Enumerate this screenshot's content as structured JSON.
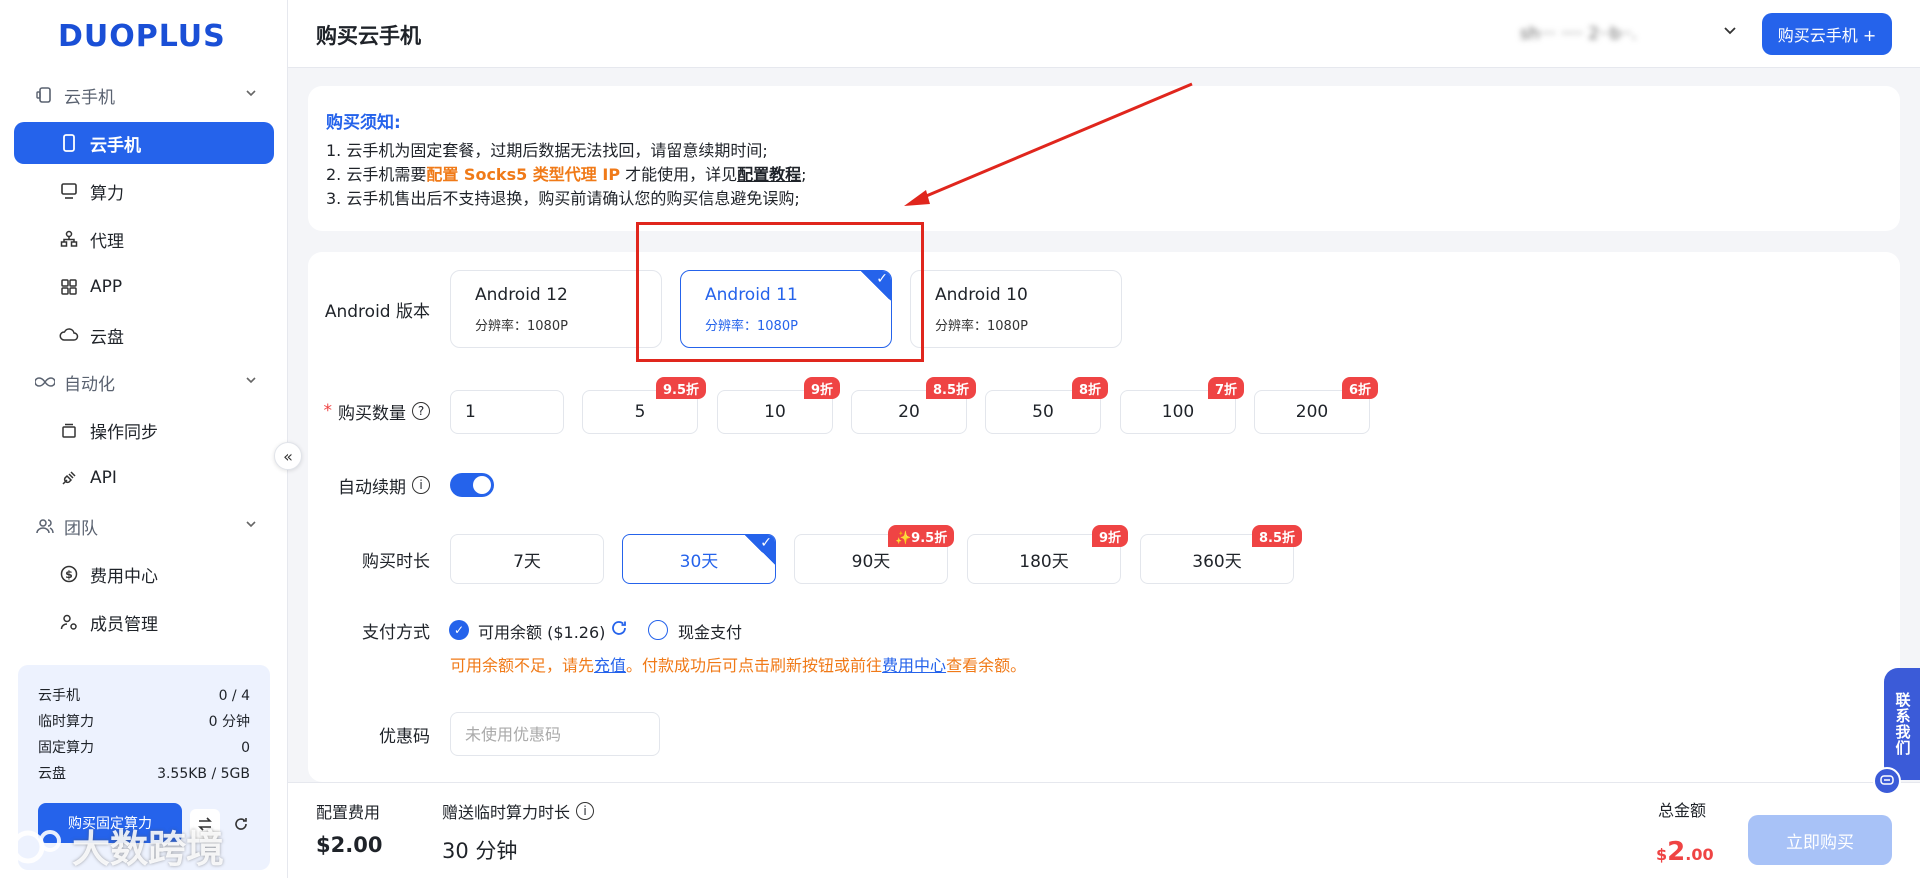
{
  "app": {
    "logo": "DUOPLUS"
  },
  "sidebar": {
    "groups": [
      {
        "label": "云手机",
        "icon": "phone-outline-icon"
      },
      {
        "label": "自动化",
        "icon": "infinity-icon"
      },
      {
        "label": "团队",
        "icon": "team-icon"
      }
    ],
    "items": [
      {
        "label": "云手机",
        "icon": "phone-icon",
        "active": true
      },
      {
        "label": "算力",
        "icon": "monitor-icon"
      },
      {
        "label": "代理",
        "icon": "network-icon"
      },
      {
        "label": "APP",
        "icon": "grid-icon"
      },
      {
        "label": "云盘",
        "icon": "cloud-icon"
      },
      {
        "label": "操作同步",
        "icon": "layers-icon"
      },
      {
        "label": "API",
        "icon": "plug-icon"
      },
      {
        "label": "费用中心",
        "icon": "dollar-icon"
      },
      {
        "label": "成员管理",
        "icon": "user-settings-icon"
      }
    ],
    "collapse_glyph": "«"
  },
  "stats": {
    "rows": [
      {
        "label": "云手机",
        "value": "0 / 4"
      },
      {
        "label": "临时算力",
        "value": "0 分钟"
      },
      {
        "label": "固定算力",
        "value": "0"
      },
      {
        "label": "云盘",
        "value": "3.55KB / 5GB"
      }
    ],
    "buy_button": "购买固定算力"
  },
  "watermark": "大数跨境",
  "header": {
    "title": "购买云手机",
    "user": "sh··· ···· 2··b··.",
    "button": "购买云手机 +"
  },
  "notice": {
    "title": "购买须知:",
    "line1": "1. 云手机为固定套餐，过期后数据无法找回，请留意续期时间;",
    "line2_a": "2. 云手机需要",
    "line2_highlight": "配置 Socks5 类型代理 IP",
    "line2_b": " 才能使用，详见",
    "line2_link": "配置教程",
    "line2_c": ";",
    "line3": "3. 云手机售出后不支持退换，购买前请确认您的购买信息避免误购;"
  },
  "form": {
    "android_label": "Android 版本",
    "versions": [
      {
        "name": "Android 12",
        "res": "分辨率：1080P",
        "selected": false
      },
      {
        "name": "Android 11",
        "res": "分辨率：1080P",
        "selected": true
      },
      {
        "name": "Android 10",
        "res": "分辨率：1080P",
        "selected": false
      }
    ],
    "qty_label": "购买数量",
    "required_mark": "*",
    "qty_input": "1",
    "quantities": [
      {
        "value": "5",
        "badge": "9.5折"
      },
      {
        "value": "10",
        "badge": "9折"
      },
      {
        "value": "20",
        "badge": "8.5折"
      },
      {
        "value": "50",
        "badge": "8折"
      },
      {
        "value": "100",
        "badge": "7折"
      },
      {
        "value": "200",
        "badge": "6折"
      }
    ],
    "renew_label": "自动续期",
    "renew_on": true,
    "duration_label": "购买时长",
    "durations": [
      {
        "value": "7天",
        "badge": "",
        "selected": false
      },
      {
        "value": "30天",
        "badge": "",
        "selected": true
      },
      {
        "value": "90天",
        "badge": "✨9.5折",
        "selected": false
      },
      {
        "value": "180天",
        "badge": "9折",
        "selected": false
      },
      {
        "value": "360天",
        "badge": "8.5折",
        "selected": false
      }
    ],
    "pay_label": "支付方式",
    "pay_balance": "可用余额 ($1.26)",
    "pay_cash": "现金支付",
    "warn_a": "可用余额不足，请先",
    "warn_link1": "充值",
    "warn_b": "。付款成功后可点击刷新按钮或前往",
    "warn_link2": "费用中心",
    "warn_c": "查看余额。",
    "coupon_label": "优惠码",
    "coupon_placeholder": "未使用优惠码"
  },
  "footer": {
    "config_fee_label": "配置费用",
    "config_fee": "$2.00",
    "bonus_label": "赠送临时算力时长",
    "bonus_value": "30 分钟",
    "total_label": "总金额",
    "total_currency": "$",
    "total_int": "2",
    "total_dec": ".00",
    "buy_now": "立即购买"
  },
  "contact": {
    "label": "联系我们"
  },
  "colors": {
    "primary": "#2563eb",
    "badge": "#ef4444",
    "warning": "#f07a18",
    "annotation": "#e0261d"
  }
}
